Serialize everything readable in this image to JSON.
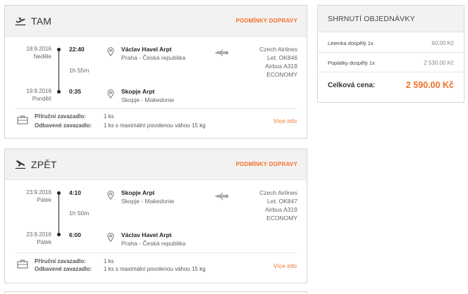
{
  "outbound": {
    "title": "TAM",
    "conditions": "PODMÍNKY DOPRAVY",
    "departure": {
      "date": "18.9.2016",
      "day": "Neděle",
      "time": "22:40",
      "airport": "Václav Havel Arpt",
      "city": "Praha - Česká republika"
    },
    "duration": "1h 55m",
    "arrival": {
      "date": "19.9.2016",
      "day": "Pondělí",
      "time": "0:35",
      "airport": "Skopje Arpt",
      "city": "Skopje - Makedonie"
    },
    "airline": "Czech Airlines",
    "flight": "Let: OK846",
    "aircraft": "Airbus A319",
    "cabin": "ECONOMY",
    "carry_on_label": "Příruční zavazadlo:",
    "carry_on_value": "1 ks",
    "checked_label": "Odbavené zavazadlo:",
    "checked_value": "1 ks s maximální povolenou váhou 15 kg",
    "more_info": "Více info"
  },
  "return": {
    "title": "ZPĚT",
    "conditions": "PODMÍNKY DOPRAVY",
    "departure": {
      "date": "23.9.2016",
      "day": "Pátek",
      "time": "4:10",
      "airport": "Skopje Arpt",
      "city": "Skopje - Makedonie"
    },
    "duration": "1h 50m",
    "arrival": {
      "date": "23.9.2016",
      "day": "Pátek",
      "time": "6:00",
      "airport": "Václav Havel Arpt",
      "city": "Praha - Česká republika"
    },
    "airline": "Czech Airlines",
    "flight": "Let: OK847",
    "aircraft": "Airbus A319",
    "cabin": "ECONOMY",
    "carry_on_label": "Příruční zavazadlo:",
    "carry_on_value": "1 ks",
    "checked_label": "Odbavené zavazadlo:",
    "checked_value": "1 ks s maximální povolenou váhou 15 kg",
    "more_info": "Více info"
  },
  "summary": {
    "title": "SHRNUTÍ OBJEDNÁVKY",
    "rows": [
      {
        "label": "Letenka dospělý 1x",
        "value": "60.00 Kč"
      },
      {
        "label": "Poplatky dospělý 1x",
        "value": "2 530.00 Kč"
      }
    ],
    "total_label": "Celková cena:",
    "total_value": "2 590.00 Kč"
  },
  "colors": {
    "accent": "#f0712c",
    "header_bg": "#f3f2f1",
    "border": "#d6d6d6"
  },
  "icons": {
    "outbound": "plane-takeoff-icon",
    "return": "plane-landing-icon",
    "location": "location-pin-icon",
    "aircraft": "airplane-icon",
    "luggage": "luggage-icon"
  }
}
